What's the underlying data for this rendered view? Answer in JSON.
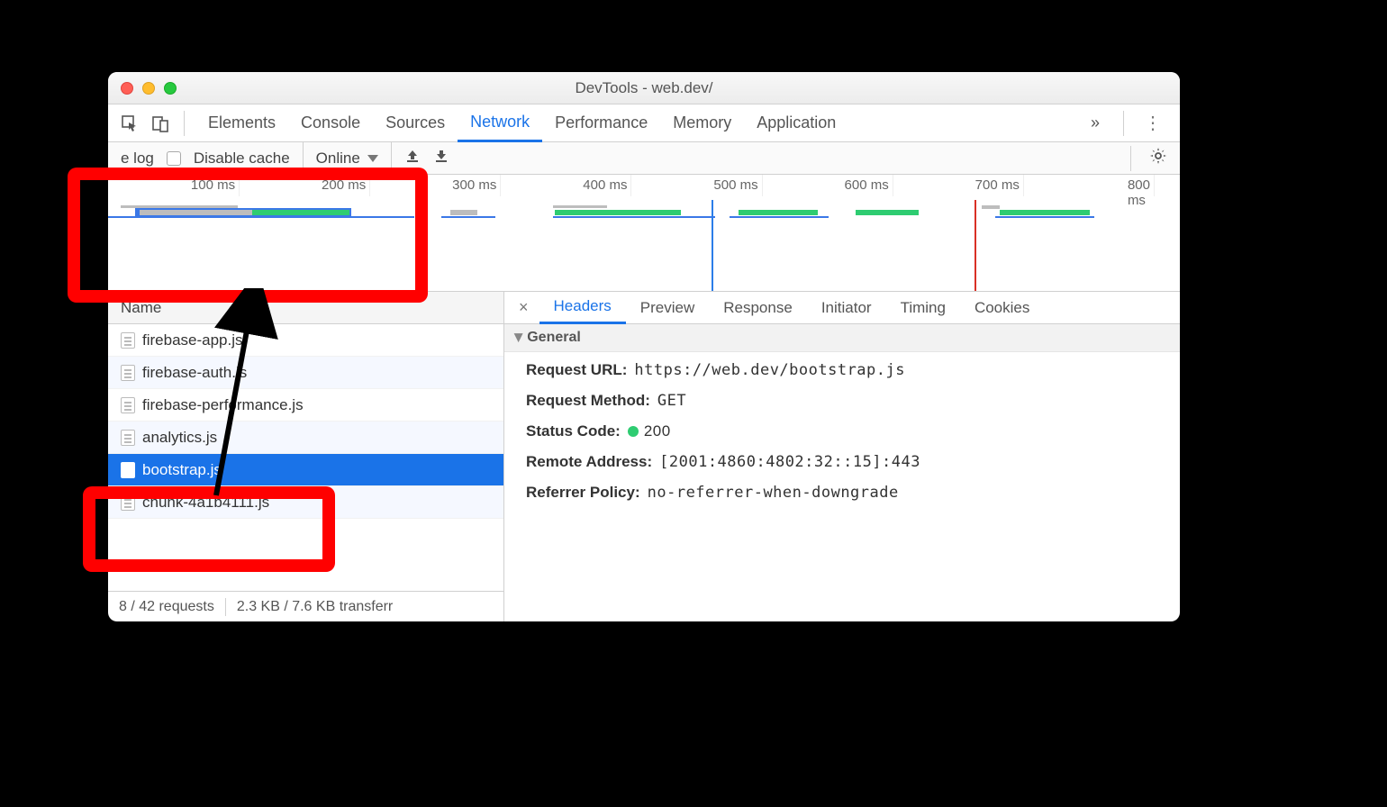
{
  "window_title": "DevTools - web.dev/",
  "main_tabs": [
    "Elements",
    "Console",
    "Sources",
    "Network",
    "Performance",
    "Memory",
    "Application"
  ],
  "main_tabs_active": "Network",
  "toolbar": {
    "preserve_log_label": "e log",
    "disable_cache_label": "Disable cache",
    "throttle_value": "Online"
  },
  "timeline_ticks": [
    "100 ms",
    "200 ms",
    "300 ms",
    "400 ms",
    "500 ms",
    "600 ms",
    "700 ms",
    "800 ms"
  ],
  "name_header": "Name",
  "requests": [
    {
      "name": "firebase-app.js"
    },
    {
      "name": "firebase-auth.js"
    },
    {
      "name": "firebase-performance.js"
    },
    {
      "name": "analytics.js"
    },
    {
      "name": "bootstrap.js",
      "selected": true
    },
    {
      "name": "chunk-4a1b4111.js"
    }
  ],
  "status": {
    "requests": "8 / 42 requests",
    "transfer": "2.3 KB / 7.6 KB transferr"
  },
  "detail_tabs": [
    "Headers",
    "Preview",
    "Response",
    "Initiator",
    "Timing",
    "Cookies"
  ],
  "detail_tabs_active": "Headers",
  "general_title": "General",
  "general": {
    "request_url_k": "Request URL:",
    "request_url_v": "https://web.dev/bootstrap.js",
    "request_method_k": "Request Method:",
    "request_method_v": "GET",
    "status_code_k": "Status Code:",
    "status_code_v": "200",
    "remote_addr_k": "Remote Address:",
    "remote_addr_v": "[2001:4860:4802:32::15]:443",
    "referrer_k": "Referrer Policy:",
    "referrer_v": "no-referrer-when-downgrade"
  }
}
